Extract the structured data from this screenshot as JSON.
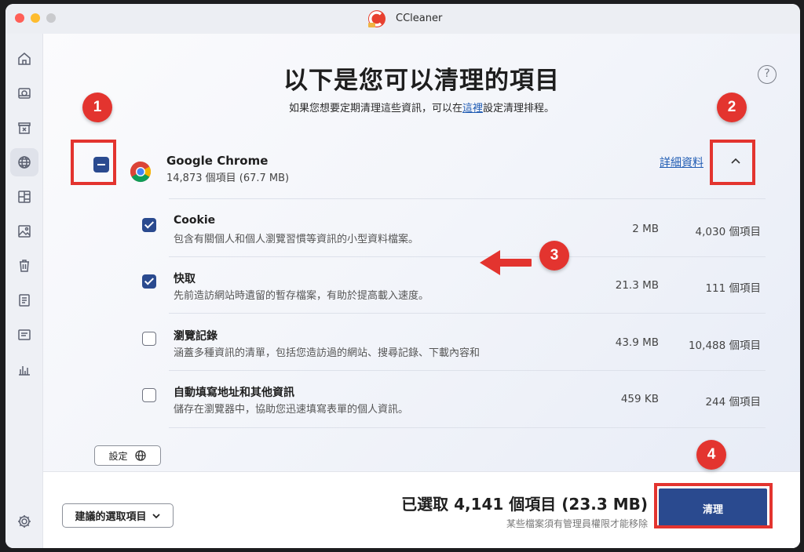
{
  "window": {
    "app_title": "CCleaner"
  },
  "sidebar": {
    "items": [
      {
        "icon": "home-icon"
      },
      {
        "icon": "health-check-icon"
      },
      {
        "icon": "cleanup-icon"
      },
      {
        "icon": "globe-icon",
        "active": true
      },
      {
        "icon": "registry-icon"
      },
      {
        "icon": "image-icon"
      },
      {
        "icon": "trash-icon"
      },
      {
        "icon": "list-icon"
      },
      {
        "icon": "terminal-icon"
      },
      {
        "icon": "chart-icon"
      }
    ],
    "bottom_icon": "settings-gear-icon"
  },
  "main": {
    "title": "以下是您可以清理的項目",
    "subtitle_pre": "如果您想要定期清理這些資訊，可以在",
    "subtitle_link": "這裡",
    "subtitle_post": "設定清理排程。",
    "help_label": "?"
  },
  "browser": {
    "name": "Google Chrome",
    "meta": "14,873 個項目 (67.7 MB)",
    "details_link": "詳細資料"
  },
  "items": [
    {
      "checked": true,
      "title": "Cookie",
      "desc": "包含有關個人和個人瀏覽習慣等資訊的小型資料檔案。",
      "size": "2 MB",
      "count": "4,030 個項目"
    },
    {
      "checked": true,
      "title": "快取",
      "desc": "先前造訪網站時遺留的暫存檔案，有助於提高載入速度。",
      "size": "21.3 MB",
      "count": "111 個項目"
    },
    {
      "checked": false,
      "title": "瀏覽記錄",
      "desc": "涵蓋多種資訊的清單，包括您造訪過的網站、搜尋記錄、下載內容和",
      "size": "43.9 MB",
      "count": "10,488 個項目"
    },
    {
      "checked": false,
      "title": "自動填寫地址和其他資訊",
      "desc": "儲存在瀏覽器中，協助您迅速填寫表單的個人資訊。",
      "size": "459 KB",
      "count": "244 個項目"
    }
  ],
  "settings_button": "設定",
  "footer": {
    "recommended_select": "建議的選取項目",
    "summary": "已選取 4,141 個項目 (23.3 MB)",
    "note": "某些檔案須有管理員權限才能移除",
    "clean_button": "清理"
  },
  "annotations": {
    "badges": [
      "1",
      "2",
      "3",
      "4"
    ],
    "badge_color": "#e3342f"
  },
  "colors": {
    "accent": "#2a4a8f",
    "link": "#1f5bb3",
    "annotation": "#e3342f"
  }
}
